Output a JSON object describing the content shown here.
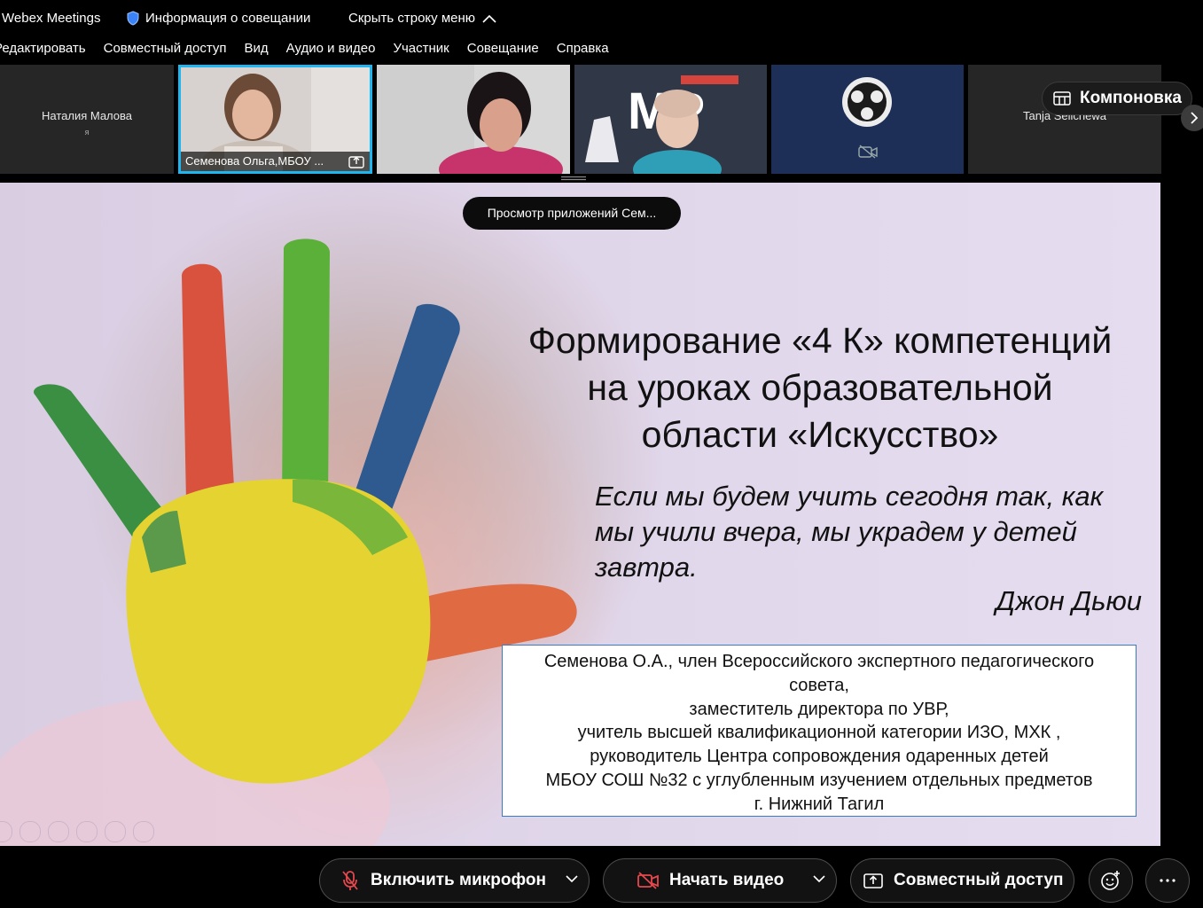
{
  "titlebar": {
    "app_name": "Webex Meetings",
    "meeting_info": "Информация о совещании",
    "hide_menu": "Скрыть строку меню"
  },
  "menu": {
    "items": [
      "Редактировать",
      "Совместный доступ",
      "Вид",
      "Аудио и видео",
      "Участник",
      "Совещание",
      "Справка"
    ]
  },
  "filmstrip": {
    "tiles": [
      {
        "name": "Наталия Малова",
        "sub": "я"
      },
      {
        "name": "Семенова Ольга,МБОУ ..."
      },
      {
        "name": ""
      },
      {
        "name": ""
      },
      {
        "name": ""
      },
      {
        "name": "Tanja Selichewa"
      }
    ],
    "layout_label": "Компоновка"
  },
  "share": {
    "view_apps": "Просмотр приложений Сем...",
    "slide": {
      "title_lines": [
        "Формирование «4 К» компетенций",
        "на уроках образовательной",
        "области «Искусство»"
      ],
      "quote_lines": [
        "Если мы будем учить сегодня так, как",
        "мы учили вчера, мы украдем у детей",
        "завтра."
      ],
      "author": "Джон Дьюи",
      "info_lines": [
        "Семенова О.А., член Всероссийского экспертного педагогического",
        "совета,",
        "заместитель директора по УВР,",
        "учитель высшей квалификационной категории ИЗО, МХК ,",
        "руководитель Центра сопровождения одаренных детей",
        "МБОУ СОШ №32 с углубленным изучением отдельных предметов",
        "г. Нижний Тагил"
      ]
    }
  },
  "controls": {
    "mic": "Включить микрофон",
    "video": "Начать видео",
    "share": "Совместный доступ"
  },
  "colors": {
    "active_tile": "#1fb6f0",
    "mic_muted": "#e5484d",
    "slide_bg": "#ddd2e6"
  }
}
